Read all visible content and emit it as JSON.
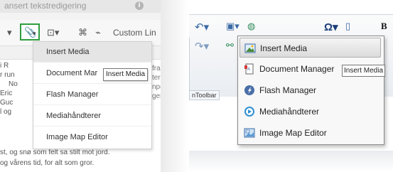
{
  "left": {
    "title_text": "ansert tekstredigering",
    "toolbar_custom_label": "Custom Lin",
    "menu_items": [
      {
        "label": "Insert Media"
      },
      {
        "label": "Document Mar"
      },
      {
        "label": "Flash Manager"
      },
      {
        "label": "Mediahåndterer"
      },
      {
        "label": "Image Map Editor"
      }
    ],
    "tooltip": "Insert Media",
    "editor_lines": [
      "i R",
      "r run",
      "No",
      "Eric",
      "Guc",
      "l og",
      "st, og snø som felt sa stilt mot jord.",
      "og vårens tid, for alt som gror."
    ],
    "editor_right_lines": [
      "fra",
      "ter",
      "npe",
      "ger"
    ]
  },
  "right": {
    "group_label": "nToolbar",
    "menu_items": [
      {
        "label": "Insert Media",
        "icon": "image-icon"
      },
      {
        "label": "Document Manager",
        "icon": "document-icon"
      },
      {
        "label": "Flash Manager",
        "icon": "flash-icon"
      },
      {
        "label": "Mediahåndterer",
        "icon": "media-player-icon"
      },
      {
        "label": "Image Map Editor",
        "icon": "image-map-icon"
      }
    ],
    "tooltip": "Insert Media"
  },
  "colors": {
    "highlight_border": "#2e9e3e",
    "accent_blue": "#3a6aa6"
  }
}
